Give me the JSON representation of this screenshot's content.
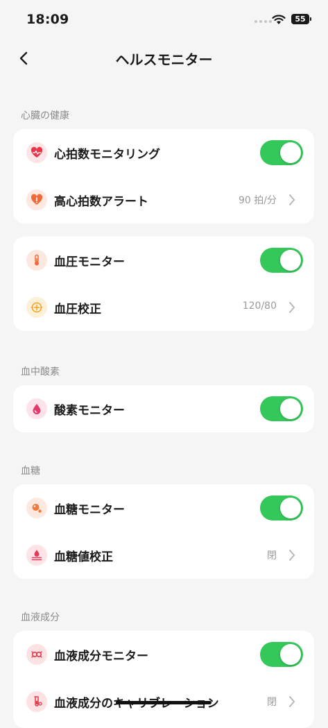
{
  "status_bar": {
    "time": "18:09",
    "battery": "55"
  },
  "nav": {
    "title": "ヘルスモニター"
  },
  "sections": {
    "heart": "心臓の健康",
    "oxygen": "血中酸素",
    "glucose": "血糖",
    "blood": "血液成分"
  },
  "rows": {
    "heart_rate": {
      "label": "心拍数モニタリング",
      "toggle": true,
      "icon": "heart-pulse-icon",
      "icon_color": "#e8374a",
      "icon_bg": "#fde4e6"
    },
    "high_alert": {
      "label": "高心拍数アラート",
      "value": "90 拍/分",
      "icon": "heart-alert-icon",
      "icon_color": "#ef6a3a",
      "icon_bg": "#fde8df"
    },
    "bp_monitor": {
      "label": "血圧モニター",
      "toggle": true,
      "icon": "thermometer-icon",
      "icon_color": "#ef6a3a",
      "icon_bg": "#fde8df"
    },
    "bp_calibration": {
      "label": "血圧校正",
      "value": "120/80",
      "icon": "calibration-icon",
      "icon_color": "#f0a020",
      "icon_bg": "#fdf0d8"
    },
    "oxygen_monitor": {
      "label": "酸素モニター",
      "toggle": true,
      "icon": "drop-icon",
      "icon_color": "#e23a6a",
      "icon_bg": "#fde2ea"
    },
    "glucose_monitor": {
      "label": "血糖モニター",
      "toggle": true,
      "icon": "glucose-icon",
      "icon_color": "#f07a3a",
      "icon_bg": "#fde8df"
    },
    "glucose_calibration": {
      "label": "血糖値校正",
      "value": "閉",
      "icon": "glucose-calibration-icon",
      "icon_color": "#e23a5a",
      "icon_bg": "#fde2e6"
    },
    "blood_monitor": {
      "label": "血液成分モニター",
      "toggle": true,
      "icon": "blood-components-icon",
      "icon_color": "#e23a4a",
      "icon_bg": "#fde2e4"
    },
    "blood_calibration": {
      "label": "血液成分のキャリブレーション",
      "value": "閉",
      "icon": "test-tube-icon",
      "icon_color": "#e23a4a",
      "icon_bg": "#fde2e4"
    }
  },
  "colors": {
    "toggle_on": "#34c759",
    "background": "#f5f5f5"
  }
}
